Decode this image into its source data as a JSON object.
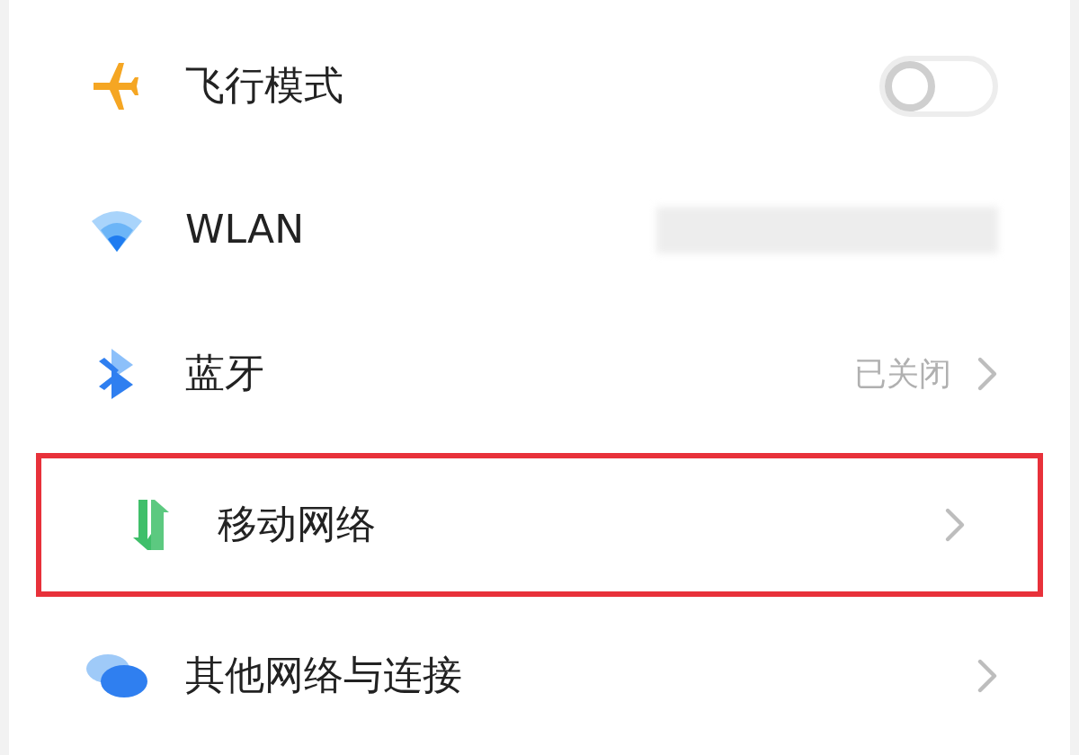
{
  "settings": [
    {
      "kind": "toggle",
      "label": "飞行模式",
      "on": false,
      "highlighted": false
    },
    {
      "kind": "redacted",
      "label": "WLAN",
      "highlighted": false
    },
    {
      "kind": "value",
      "label": "蓝牙",
      "value": "已关闭",
      "highlighted": false
    },
    {
      "kind": "link",
      "label": "移动网络",
      "highlighted": true
    },
    {
      "kind": "link",
      "label": "其他网络与连接",
      "highlighted": false
    }
  ]
}
